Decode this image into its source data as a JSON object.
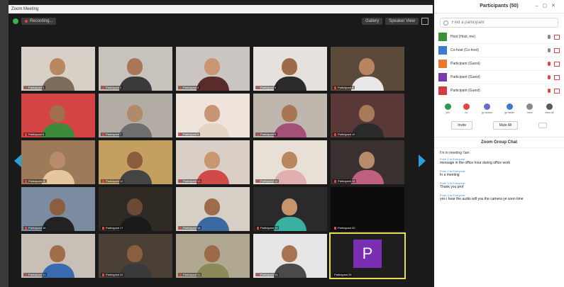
{
  "window": {
    "title": "Zoom Meeting"
  },
  "topbar": {
    "recording_label": "Recording...",
    "view_a": "Gallery",
    "view_b": "Speaker View"
  },
  "tiles": [
    {
      "label": "Participant 1",
      "bg": "#d8d0c6",
      "skin": "#b88863",
      "shirt": "#7d6b5b"
    },
    {
      "label": "Participant 2",
      "bg": "#c7c2bb",
      "skin": "#a87856",
      "shirt": "#3a3a3a"
    },
    {
      "label": "Participant 3",
      "bg": "#cbc6c1",
      "skin": "#c89673",
      "shirt": "#5a2b2b"
    },
    {
      "label": "Participant 4",
      "bg": "#e6e1dc",
      "skin": "#9c6b4a",
      "shirt": "#2b2b2b"
    },
    {
      "label": "Participant 5",
      "bg": "#5b4a3a",
      "skin": "#b88460",
      "shirt": "#e8e8e8"
    },
    {
      "label": "Participant 6",
      "bg": "#d54444",
      "skin": "#a06f4f",
      "shirt": "#3a8a3a"
    },
    {
      "label": "Participant 7",
      "bg": "#b3aca4",
      "skin": "#b08b6a",
      "shirt": "#6e6e6e"
    },
    {
      "label": "Participant 8",
      "bg": "#eee4dc",
      "skin": "#c89473",
      "shirt": "#e6d4c4"
    },
    {
      "label": "Participant 9",
      "bg": "#bfb6ad",
      "skin": "#a87654",
      "shirt": "#a55077"
    },
    {
      "label": "Participant 10",
      "bg": "#5a3838",
      "skin": "#a87a5a",
      "shirt": "#2b2b2b"
    },
    {
      "label": "Participant 11",
      "bg": "#9c7a5a",
      "skin": "#b88c68",
      "shirt": "#e6c69c"
    },
    {
      "label": "Participant 12",
      "bg": "#c4a060",
      "skin": "#8c5c3c",
      "shirt": "#444"
    },
    {
      "label": "Participant 13",
      "bg": "#d9cfc6",
      "skin": "#c8966f",
      "shirt": "#d04a4a"
    },
    {
      "label": "Participant 14",
      "bg": "#e8e0d6",
      "skin": "#b8865f",
      "shirt": "#e0b0b0"
    },
    {
      "label": "Participant 15",
      "bg": "#3a3030",
      "skin": "#b88c6a",
      "shirt": "#c06080"
    },
    {
      "label": "Participant 16",
      "bg": "#7b8ca0",
      "skin": "#8c5e40",
      "shirt": "#222"
    },
    {
      "label": "Participant 17",
      "bg": "#302a24",
      "skin": "#6a4a34",
      "shirt": "#1a1a1a"
    },
    {
      "label": "Participant 18",
      "bg": "#d6cfc6",
      "skin": "#9c6c4c",
      "shirt": "#3a6aa0"
    },
    {
      "label": "Participant 19",
      "bg": "#2a2a2a",
      "skin": "#c8946c",
      "shirt": "#3ab0a0"
    },
    {
      "label": "Participant 20",
      "bg": "#0c0c0c",
      "skin": "#0c0c0c",
      "shirt": "#0c0c0c"
    },
    {
      "label": "Participant 21",
      "bg": "#c8c0b6",
      "skin": "#a06c4a",
      "shirt": "#3a6ab0"
    },
    {
      "label": "Participant 22",
      "bg": "#4a4036",
      "skin": "#8c5e40",
      "shirt": "#3a3a3a"
    },
    {
      "label": "Participant 23",
      "bg": "#b0a890",
      "skin": "#9c6a48",
      "shirt": "#8a8a5a"
    },
    {
      "label": "Participant 24",
      "bg": "#e6e6e6",
      "skin": "#a87452",
      "shirt": "#4a4a4a"
    }
  ],
  "active_tile": {
    "initial": "P",
    "label": "Participant 25"
  },
  "sidebar": {
    "title": "Participants (50)",
    "search_placeholder": "Find a participant",
    "participants": [
      {
        "name": "Host (Host, me)",
        "avatar": "#3c8d3c"
      },
      {
        "name": "Co-host (Co-host)",
        "avatar": "#3a7ad0"
      },
      {
        "name": "Participant (Guest)",
        "avatar": "#e87a2e"
      },
      {
        "name": "Participant (Guest)",
        "avatar": "#7a3ab0"
      },
      {
        "name": "Participant (Guest)",
        "avatar": "#d04040"
      }
    ],
    "reactions": [
      {
        "label": "yes",
        "color": "#2a9c4a"
      },
      {
        "label": "no",
        "color": "#e04444"
      },
      {
        "label": "go slower",
        "color": "#6a6ad0"
      },
      {
        "label": "go faster",
        "color": "#3a7ad0"
      },
      {
        "label": "more",
        "color": "#8a8a8a"
      },
      {
        "label": "clear all",
        "color": "#5a5a5a"
      }
    ],
    "mute_all": "Invite",
    "unmute_all": "Mute All"
  },
  "chat": {
    "title": "Zoom Group Chat",
    "first_line": "I'm in meeting I'am",
    "messages": [
      {
        "meta": "From 1 to Everyone:",
        "text": "message in the office hour during office work"
      },
      {
        "meta": "From 2 to Everyone:",
        "text": "In a meeting"
      },
      {
        "meta": "From 3 to Everyone:",
        "text": "Thank you prof"
      },
      {
        "meta": "From 4 to Everyone:",
        "text": "yes i hear the audio will you the camera ye soon time"
      }
    ]
  }
}
